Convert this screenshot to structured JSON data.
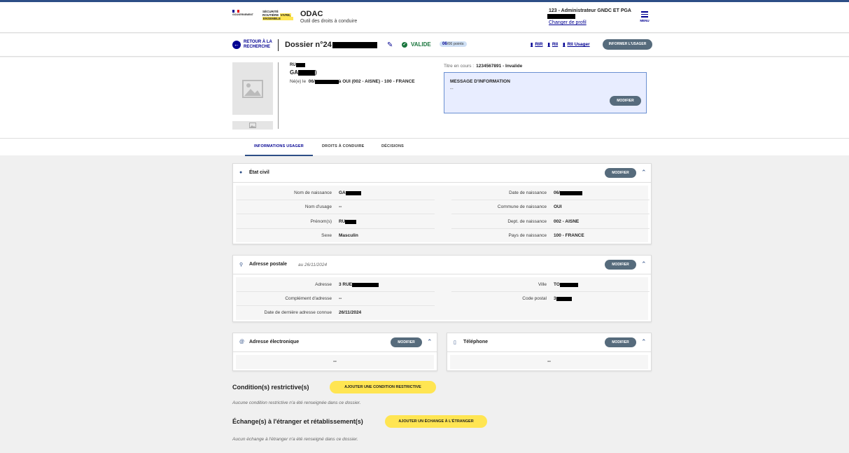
{
  "header": {
    "gov_logo_text": "GOUVERNEMENT",
    "sr_logo": [
      "SÉCURITÉ",
      "ROUTIÈRE",
      "VIVRE,",
      "ENSEMBLE"
    ],
    "app_title": "ODAC",
    "app_subtitle": "Outil des droits à conduire",
    "admin_label": "123 - Administrateur GNDC ET PGA",
    "profile_link": "Changer de profil",
    "menu_label": "MENU"
  },
  "dossier_bar": {
    "back_label": "RETOUR À LA RECHERCHE",
    "title": "Dossier n°24",
    "status": "VALIDE",
    "points_value": "06",
    "points_suffix": "/06 points",
    "doc_links": [
      "RIR",
      "RII",
      "RII Usager"
    ],
    "inform_button": "INFORMER L'USAGER"
  },
  "profile": {
    "name_line1": "RU",
    "name_line2": "GA",
    "name_line2_suffix": ")",
    "born_label": "Né(e) le",
    "born_date_prefix": "06/",
    "born_place": "à OUI (002 - AISNE) - 100 - FRANCE",
    "titre_label": "Titre en cours :",
    "titre_value": "1234567891 - Invalide",
    "message_title": "MESSAGE D'INFORMATION",
    "message_body": "--",
    "message_button": "MODIFIER"
  },
  "tabs": [
    "INFORMATIONS USAGER",
    "DROITS À CONDUIRE",
    "DÉCISIONS"
  ],
  "etat_civil": {
    "title": "État civil",
    "button": "MODIFIER",
    "left": [
      {
        "label": "Nom de naissance",
        "value": "GA"
      },
      {
        "label": "Nom d'usage",
        "value": "--"
      },
      {
        "label": "Prénom(s)",
        "value": "RU"
      },
      {
        "label": "Sexe",
        "value": "Masculin"
      }
    ],
    "right": [
      {
        "label": "Date de naissance",
        "value": "06/"
      },
      {
        "label": "Commune de naissance",
        "value": "OUI"
      },
      {
        "label": "Dept. de naissance",
        "value": "002 - AISNE"
      },
      {
        "label": "Pays de naissance",
        "value": "100 - FRANCE"
      }
    ]
  },
  "adresse": {
    "title": "Adresse postale",
    "date": "au 26/11/2024",
    "button": "MODIFIER",
    "left": [
      {
        "label": "Adresse",
        "value": "3 RUE"
      },
      {
        "label": "Complément d'adresse",
        "value": "--"
      },
      {
        "label": "Date de dernière adresse connue",
        "value": "26/11/2024"
      }
    ],
    "right": [
      {
        "label": "Ville",
        "value": "TO"
      },
      {
        "label": "Code postal",
        "value": "3"
      }
    ]
  },
  "email": {
    "title": "Adresse électronique",
    "button": "MODIFIER",
    "value": "--"
  },
  "phone": {
    "title": "Téléphone",
    "button": "MODIFIER",
    "value": "--"
  },
  "conditions": {
    "title": "Condition(s) restrictive(s)",
    "button": "AJOUTER UNE CONDITION RESTRICTIVE",
    "empty": "Aucune condition restrictive n'a été renseignée dans ce dossier."
  },
  "echanges": {
    "title": "Échange(s) à l'étranger et rétablissement(s)",
    "button": "AJOUTER UN ÉCHANGE À L'ÉTRANGER",
    "empty": "Aucun échange à l'étranger n'a été renseigné dans ce dossier."
  },
  "colors": {
    "primary": "#000091",
    "valid": "#18753c",
    "button_dark": "#566b7c",
    "yellow": "#ffe552"
  }
}
